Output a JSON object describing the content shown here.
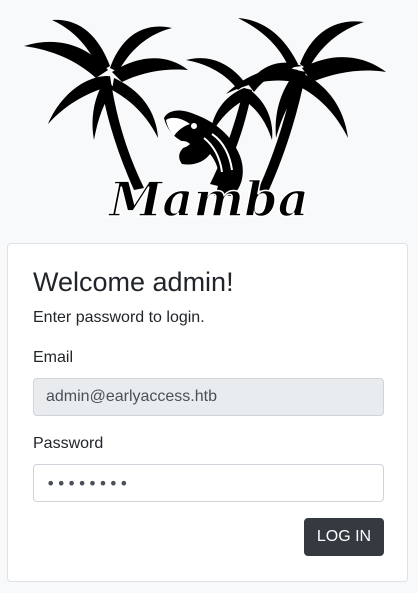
{
  "logo": {
    "text": "Mamba",
    "colors": {
      "ink": "#000000",
      "background": "#f8f9fa"
    }
  },
  "login_card": {
    "title": "Welcome admin!",
    "subtitle": "Enter password to login.",
    "email": {
      "label": "Email",
      "value": "admin@earlyaccess.htb"
    },
    "password": {
      "label": "Password",
      "value": "********"
    },
    "submit_label": "LOG IN"
  },
  "colors": {
    "page_background": "#f8f9fa",
    "button_background": "#343a40",
    "readonly_input_background": "#e9ecef",
    "border": "#dee2e6"
  }
}
